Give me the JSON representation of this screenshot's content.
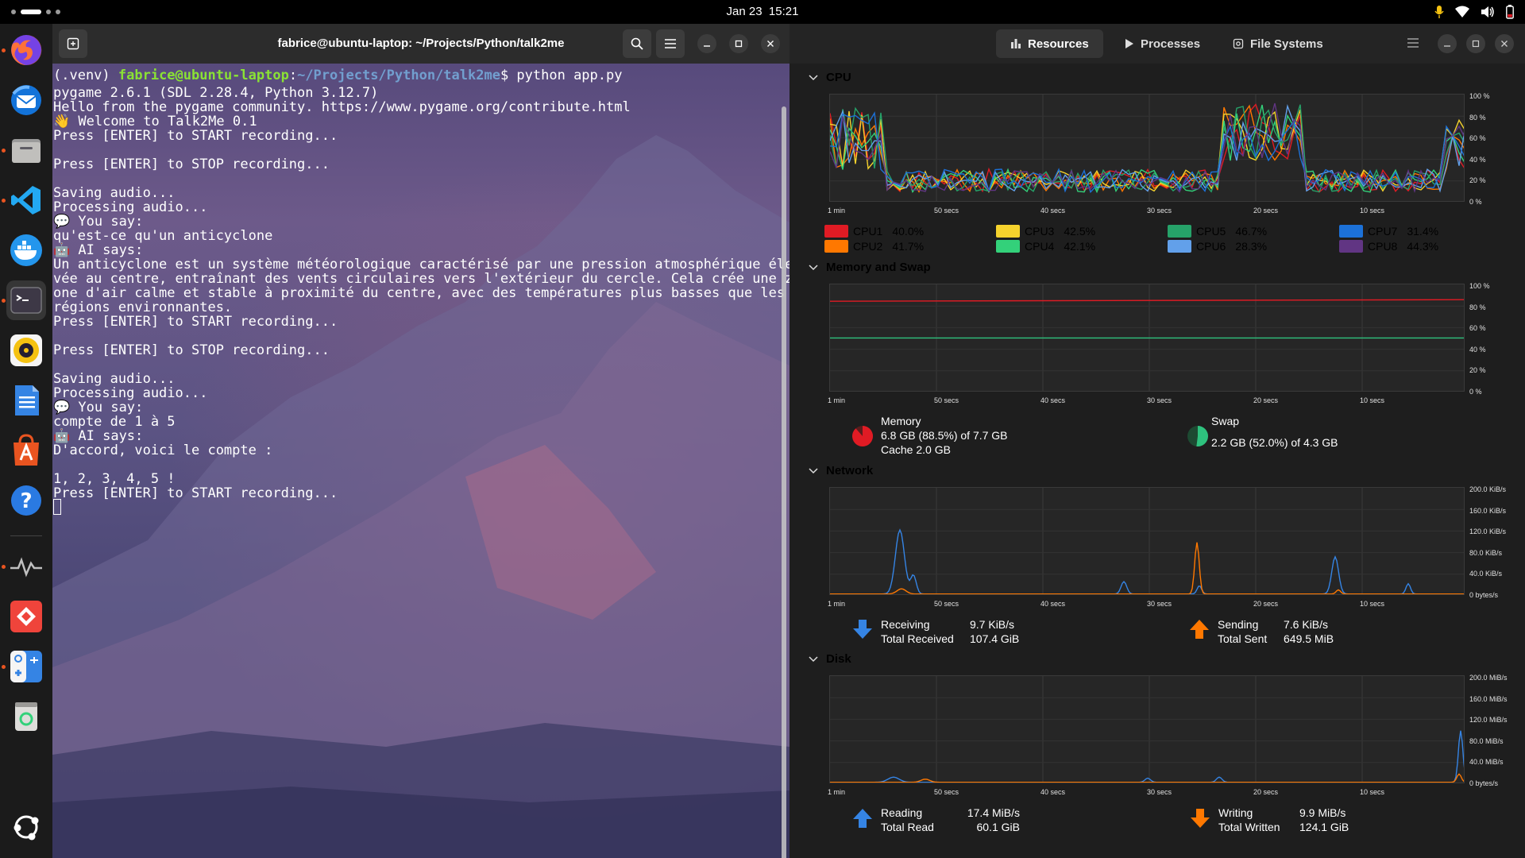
{
  "topbar": {
    "clock_date": "Jan 23",
    "clock_time": "15:21"
  },
  "dock": {
    "apps": [
      {
        "name": "firefox",
        "color": "#ff7139"
      },
      {
        "name": "thunderbird",
        "color": "#2a7ae2"
      },
      {
        "name": "files",
        "color": "#8a8a8a"
      },
      {
        "name": "vscode",
        "color": "#1e90ff"
      },
      {
        "name": "docker",
        "color": "#2496ed"
      },
      {
        "name": "terminal",
        "color": "#3a3a3a"
      },
      {
        "name": "rhythmbox",
        "color": "#f5c211"
      },
      {
        "name": "libreoffice-writer",
        "color": "#1e6fd9"
      },
      {
        "name": "app-center",
        "color": "#e95420"
      },
      {
        "name": "help",
        "color": "#2a7ae2"
      },
      {
        "name": "system-monitor",
        "color": "#2a2a2a"
      },
      {
        "name": "anydesk",
        "color": "#ef443b"
      },
      {
        "name": "extension-manager",
        "color": "#3584e4"
      },
      {
        "name": "trash",
        "color": "#5c9e3d"
      }
    ]
  },
  "terminal": {
    "title": "fabrice@ubuntu-laptop: ~/Projects/Python/talk2me",
    "prompt_env": "(.venv) ",
    "prompt_user": "fabrice@ubuntu-laptop",
    "prompt_sep": ":",
    "prompt_path": "~/Projects/Python/talk2me",
    "prompt_cmd": "$ python app.py",
    "lines": [
      "pygame 2.6.1 (SDL 2.28.4, Python 3.12.7)",
      "Hello from the pygame community. https://www.pygame.org/contribute.html",
      "👋 Welcome to Talk2Me 0.1",
      "Press [ENTER] to START recording...",
      "",
      "Press [ENTER] to STOP recording...",
      "",
      "Saving audio...",
      "Processing audio...",
      "💬 You say:",
      "qu'est-ce qu'un anticyclone",
      "🤖 AI says:",
      "Un anticyclone est un système météorologique caractérisé par une pression atmosphérique éle",
      "vée au centre, entraînant des vents circulaires vers l'extérieur du cercle. Cela crée une z",
      "one d'air calme et stable à proximité du centre, avec des températures plus basses que les",
      "régions environnantes.",
      "Press [ENTER] to START recording...",
      "",
      "Press [ENTER] to STOP recording...",
      "",
      "Saving audio...",
      "Processing audio...",
      "💬 You say:",
      "compte de 1 à 5",
      "🤖 AI says:",
      "D'accord, voici le compte :",
      "",
      "1, 2, 3, 4, 5 !",
      "Press [ENTER] to START recording..."
    ]
  },
  "sysmon": {
    "tabs": [
      "Resources",
      "Processes",
      "File Systems"
    ],
    "x_ticks": [
      "1 min",
      "50 secs",
      "40 secs",
      "30 secs",
      "20 secs",
      "10 secs"
    ],
    "cpu": {
      "title": "CPU",
      "y_ticks": [
        "100 %",
        "80 %",
        "60 %",
        "40 %",
        "20 %",
        "0 %"
      ],
      "legend": [
        {
          "name": "CPU1",
          "value": "40.0%",
          "color": "#e01b24"
        },
        {
          "name": "CPU2",
          "value": "41.7%",
          "color": "#ff7800"
        },
        {
          "name": "CPU3",
          "value": "42.5%",
          "color": "#f6d32d"
        },
        {
          "name": "CPU4",
          "value": "42.1%",
          "color": "#33d17a"
        },
        {
          "name": "CPU5",
          "value": "46.7%",
          "color": "#26a269"
        },
        {
          "name": "CPU6",
          "value": "28.3%",
          "color": "#62a0ea"
        },
        {
          "name": "CPU7",
          "value": "31.4%",
          "color": "#1c71d8"
        },
        {
          "name": "CPU8",
          "value": "44.3%",
          "color": "#613583"
        }
      ]
    },
    "memory": {
      "title": "Memory and Swap",
      "y_ticks": [
        "100 %",
        "80 %",
        "60 %",
        "40 %",
        "20 %",
        "0 %"
      ],
      "mem_label": "Memory",
      "mem_line1": "6.8 GB (88.5%) of 7.7 GB",
      "mem_line2": "Cache 2.0 GB",
      "mem_fraction": 0.885,
      "mem_color": "#e01b24",
      "swap_label": "Swap",
      "swap_line1": "2.2 GB (52.0%) of 4.3 GB",
      "swap_fraction": 0.52,
      "swap_color": "#2ec27e"
    },
    "network": {
      "title": "Network",
      "y_ticks": [
        "200.0 KiB/s",
        "160.0 KiB/s",
        "120.0 KiB/s",
        "80.0 KiB/s",
        "40.0 KiB/s",
        "0 bytes/s"
      ],
      "recv_label": "Receiving",
      "recv_value": "9.7 KiB/s",
      "recv_total_label": "Total Received",
      "recv_total": "107.4 GiB",
      "send_label": "Sending",
      "send_value": "7.6 KiB/s",
      "send_total_label": "Total Sent",
      "send_total": "649.5 MiB"
    },
    "disk": {
      "title": "Disk",
      "y_ticks": [
        "200.0 MiB/s",
        "160.0 MiB/s",
        "120.0 MiB/s",
        "80.0 MiB/s",
        "40.0 MiB/s",
        "0 bytes/s"
      ],
      "read_label": "Reading",
      "read_value": "17.4 MiB/s",
      "read_total_label": "Total Read",
      "read_total": "60.1 GiB",
      "write_label": "Writing",
      "write_value": "9.9 MiB/s",
      "write_total_label": "Total Written",
      "write_total": "124.1 GiB"
    }
  }
}
